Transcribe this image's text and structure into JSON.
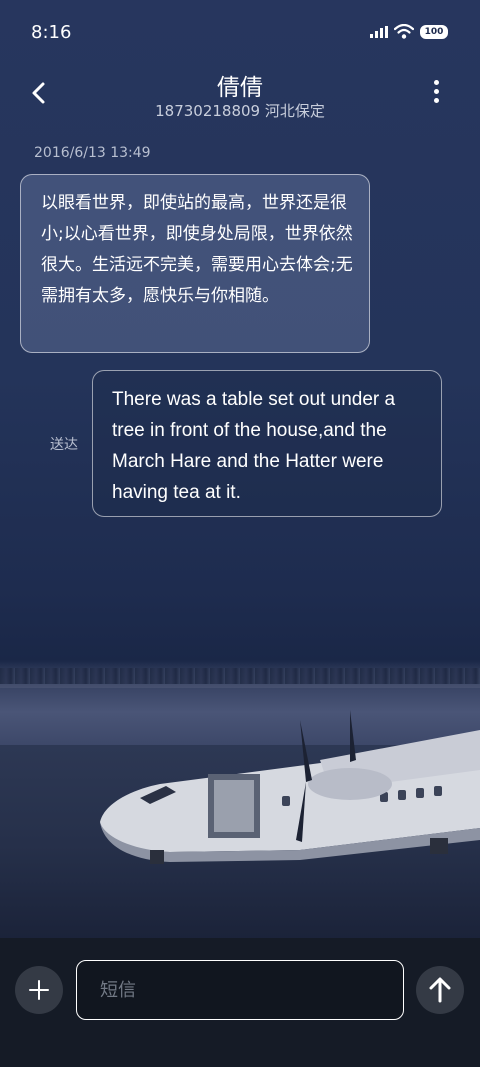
{
  "status_bar": {
    "time": "8:16",
    "battery": "100"
  },
  "header": {
    "contact_name": "倩倩",
    "contact_sub": "18730218809 河北保定"
  },
  "conversation": {
    "timestamp": "2016/6/13 13:49",
    "messages": [
      {
        "direction": "incoming",
        "text": "以眼看世界，即使站的最高，世界还是很小;以心看世界，即使身处局限，世界依然很大。生活远不完美，需要用心去体会;无需拥有太多，愿快乐与你相随。"
      },
      {
        "direction": "outgoing",
        "status": "送达",
        "text": "There was a table set out under a tree in front of the house,and the March Hare and the Hatter were having tea at it."
      }
    ]
  },
  "composer": {
    "placeholder": "短信"
  },
  "icons": {
    "back": "chevron-left-icon",
    "menu": "more-vertical-icon",
    "add": "plus-icon",
    "send": "arrow-up-icon",
    "signal": "signal-icon",
    "wifi": "wifi-icon",
    "battery": "battery-icon"
  },
  "colors": {
    "background_top": "#27365e",
    "composer_bg": "#151b26",
    "round_button_bg": "#343a45"
  }
}
